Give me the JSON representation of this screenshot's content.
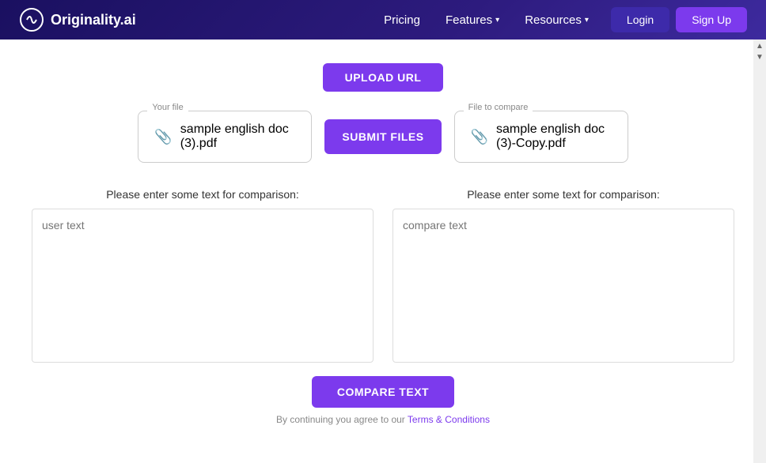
{
  "nav": {
    "logo_text": "Originality.ai",
    "links": [
      {
        "label": "Pricing",
        "has_dropdown": false
      },
      {
        "label": "Features",
        "has_dropdown": true
      },
      {
        "label": "Resources",
        "has_dropdown": true
      }
    ],
    "login_label": "Login",
    "signup_label": "Sign Up"
  },
  "upload": {
    "upload_url_label": "UPLOAD URL"
  },
  "file_inputs": {
    "your_file_label": "Your file",
    "your_file_name_line1": "sample english doc",
    "your_file_name_line2": "(3).pdf",
    "submit_files_label": "SUBMIT FILES",
    "file_to_compare_label": "File to compare",
    "compare_file_name_line1": "sample english doc",
    "compare_file_name_line2": "(3)-Copy.pdf"
  },
  "text_compare": {
    "left_label": "Please enter some text for comparison:",
    "right_label": "Please enter some text for comparison:",
    "left_placeholder": "user text",
    "right_placeholder": "compare text",
    "compare_btn_label": "COMPARE TEXT",
    "terms_text": "By continuing you agree to our ",
    "terms_link_label": "Terms & Conditions"
  }
}
